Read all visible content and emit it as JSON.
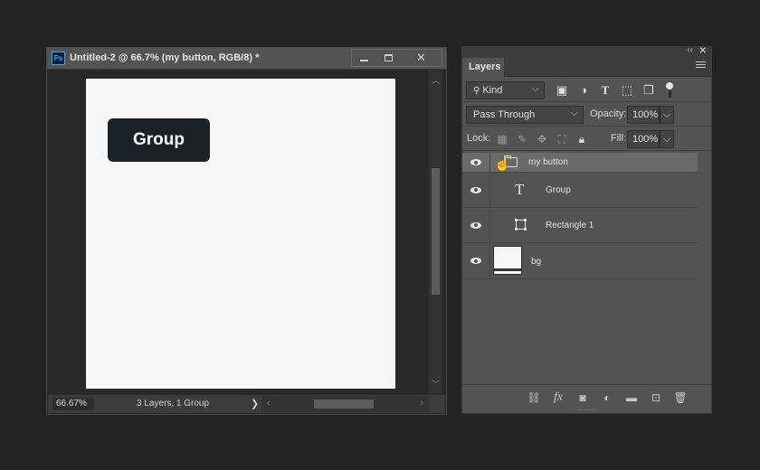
{
  "document": {
    "title": "Untitled-2 @ 66.7% (my button, RGB/8) *",
    "app_icon": "Ps",
    "window_controls": {
      "minimize": "minimize-icon",
      "maximize": "maximize-icon",
      "close": "✕"
    },
    "canvas": {
      "button_label": "Group",
      "button_color": "#1b2124",
      "background_color": "#f6f6f6"
    },
    "zoom": "66.67%",
    "info": "3 Layers, 1 Group"
  },
  "layers_panel": {
    "tab": "Layers",
    "filter": {
      "kind_label": "Kind",
      "icons": [
        "image-filter-icon",
        "adjustment-filter-icon",
        "type-filter-icon",
        "shape-filter-icon",
        "smart-object-filter-icon"
      ]
    },
    "blend_mode": "Pass Through",
    "opacity_label": "Opacity:",
    "opacity_value": "100%",
    "lock_label": "Lock:",
    "fill_label": "Fill:",
    "fill_value": "100%",
    "layers": [
      {
        "name": "my button",
        "kind": "group",
        "visible": true,
        "selected": true
      },
      {
        "name": "Group",
        "kind": "type",
        "visible": true
      },
      {
        "name": "Rectangle 1",
        "kind": "shape",
        "visible": true
      },
      {
        "name": "bg",
        "kind": "pixel",
        "visible": true
      }
    ],
    "footer_icons": [
      "link-icon",
      "fx-icon",
      "mask-icon",
      "adjustment-layer-icon",
      "new-group-icon",
      "new-layer-icon",
      "trash-icon"
    ]
  }
}
